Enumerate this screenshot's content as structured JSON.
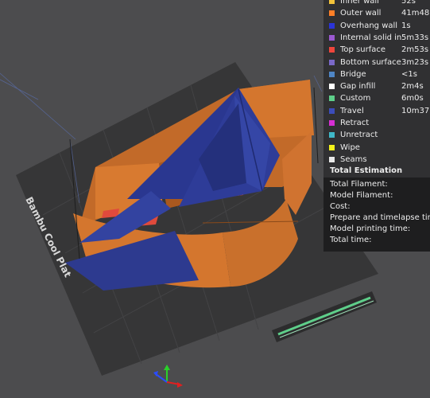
{
  "viewport": {
    "plate_label": "Bambu Cool Plat",
    "colors": {
      "background": "#4c4c4e",
      "plate": "#363637",
      "plate_grid": "#444446",
      "outer_wall": "#d4762e",
      "overhang": "#2d3a8f",
      "top_surface": "#e04a3c"
    }
  },
  "legend": {
    "rows": [
      {
        "label": "Inner wall",
        "value": "52s",
        "color": "#f2c23a"
      },
      {
        "label": "Outer wall",
        "value": "41m48",
        "color": "#ff7f27"
      },
      {
        "label": "Overhang wall",
        "value": "1s",
        "color": "#2b34d8"
      },
      {
        "label": "Internal solid infill",
        "value": "5m33s",
        "color": "#9b59d0"
      },
      {
        "label": "Top surface",
        "value": "2m53s",
        "color": "#f0463c"
      },
      {
        "label": "Bottom surface",
        "value": "3m23s",
        "color": "#7a68c8"
      },
      {
        "label": "Bridge",
        "value": "<1s",
        "color": "#4f86c6"
      },
      {
        "label": "Gap infill",
        "value": "2m4s",
        "color": "#ffffff"
      },
      {
        "label": "Custom",
        "value": "6m0s",
        "color": "#5ecf8a"
      },
      {
        "label": "Travel",
        "value": "10m37",
        "color": "#3c4dba"
      },
      {
        "label": "Retract",
        "value": "",
        "color": "#d62fd3"
      },
      {
        "label": "Unretract",
        "value": "",
        "color": "#3fb8c8"
      },
      {
        "label": "Wipe",
        "value": "",
        "color": "#f4f21a"
      },
      {
        "label": "Seams",
        "value": "",
        "color": "#e8e8e8"
      }
    ],
    "total_title": "Total Estimation",
    "totals": [
      "Total Filament:",
      "Model Filament:",
      "Cost:",
      "Prepare and timelapse time:",
      "Model printing time:",
      "Total time:"
    ]
  }
}
